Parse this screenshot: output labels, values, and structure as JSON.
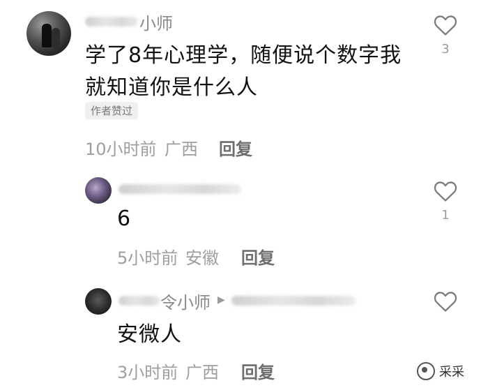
{
  "comments": [
    {
      "name_visible": "小师",
      "text_line1": "学了8年心理学，随便说个数字我",
      "text_line2": "就知道你是什么人",
      "badge": "作者赞过",
      "time": "10小时前",
      "location": "广西",
      "reply_label": "回复",
      "likes": "3"
    },
    {
      "text": "6",
      "time": "5小时前",
      "location": "安徽",
      "reply_label": "回复",
      "likes": "1"
    },
    {
      "name_visible": "令小师",
      "reply_arrow": "▶",
      "text": "安微人",
      "time": "3小时前",
      "location": "广西",
      "reply_label": "回复",
      "likes": ""
    }
  ],
  "watermark": "采采"
}
